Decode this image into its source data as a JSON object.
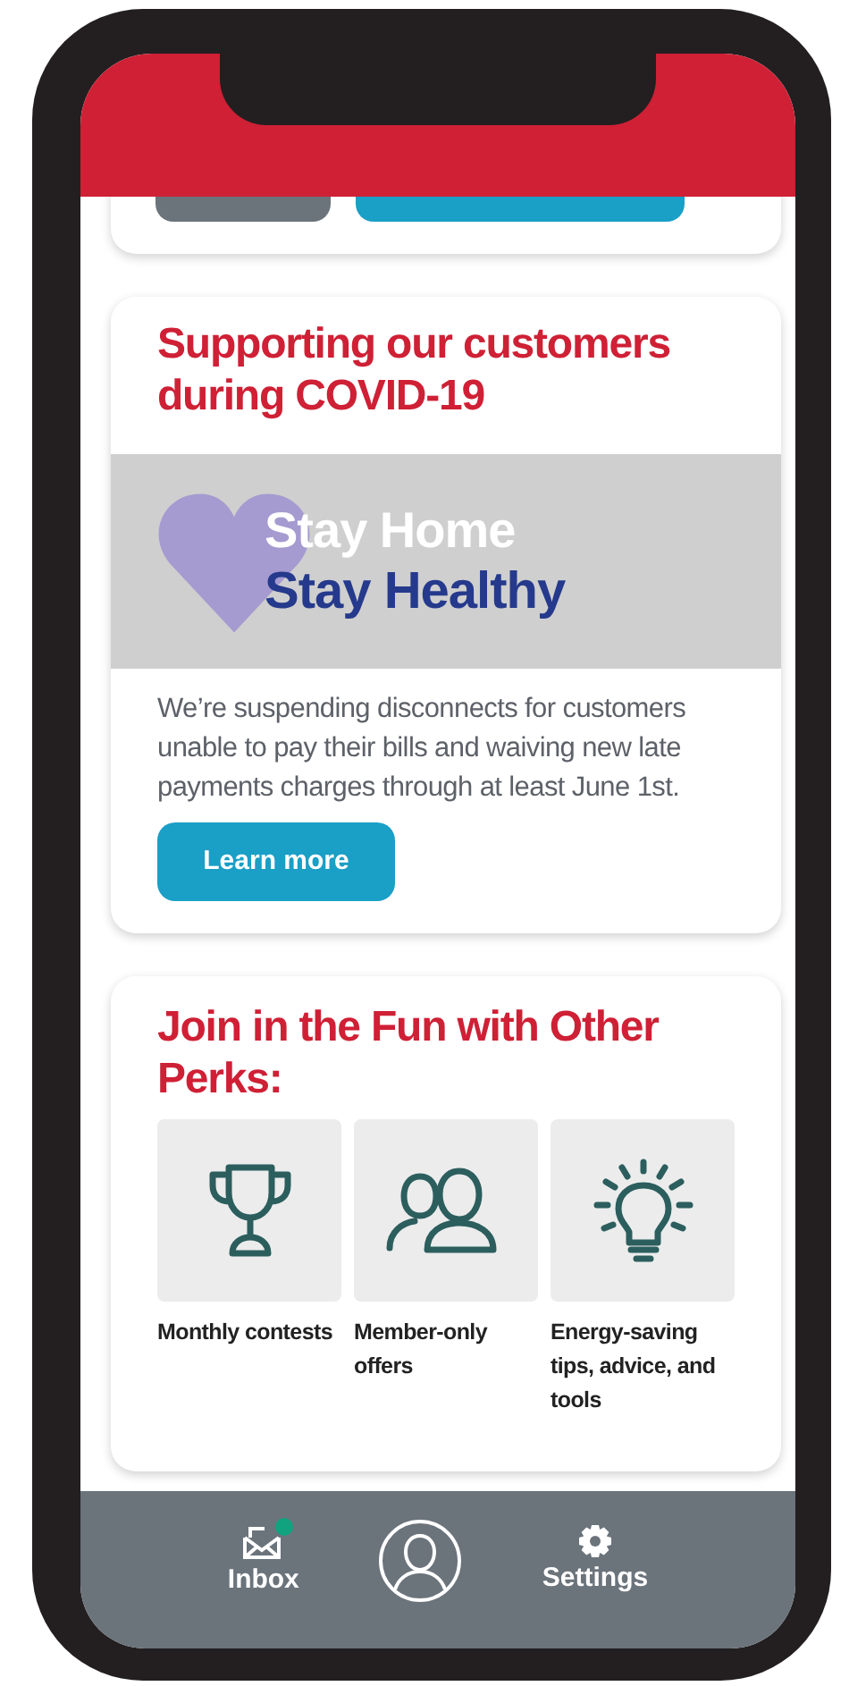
{
  "top_card": {
    "buttons": [
      {
        "kind": "secondary"
      },
      {
        "kind": "primary"
      }
    ]
  },
  "covid_card": {
    "title": "Supporting our customers during COVID-19",
    "banner": {
      "line_1": "Stay Home",
      "line_2": "Stay Healthy"
    },
    "text": "We’re suspending disconnects for customers unable to pay their bills and waiving new late payments charges through at least June 1st.",
    "button": "Learn more"
  },
  "perks_card": {
    "title": "Join in the Fun with Other Perks:",
    "perks": [
      {
        "label": "Monthly contests"
      },
      {
        "label": "Member-only offers"
      },
      {
        "label": "Energy-saving tips, advice, and tools"
      }
    ]
  },
  "bottom_nav": [
    {
      "kind": "inbox",
      "label": "Inbox",
      "unread": true
    },
    {
      "kind": "profile"
    },
    {
      "kind": "settings",
      "label": "Settings"
    }
  ]
}
